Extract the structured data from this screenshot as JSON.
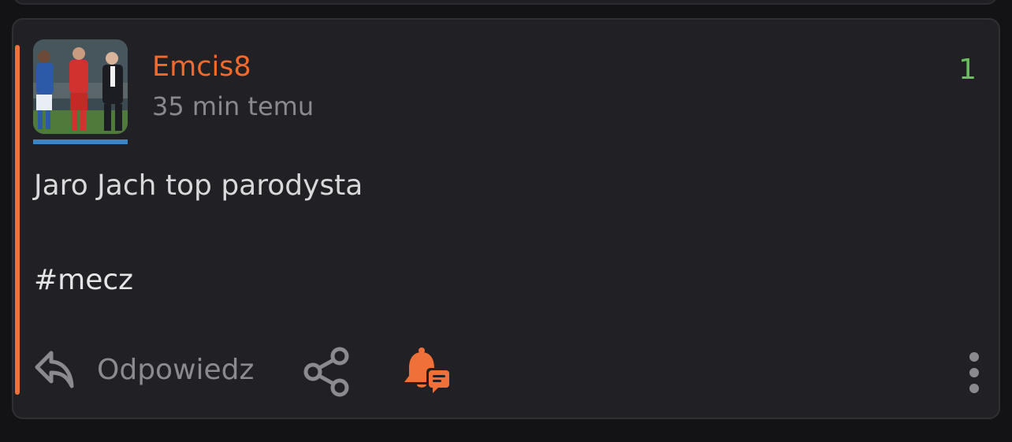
{
  "post": {
    "author": "Emcis8",
    "timestamp": "35 min temu",
    "vote_count": "1",
    "body": "Jaro Jach top parodysta",
    "tag": "#mecz"
  },
  "actions": {
    "reply_label": "Odpowiedz",
    "reply_icon": "reply-arrow-icon",
    "share_icon": "share-icon",
    "notify_icon": "bell-comment-icon",
    "more_icon": "more-vertical-icon"
  },
  "colors": {
    "background": "#131315",
    "card": "#212125",
    "accent": "#f0703a",
    "username": "#f46a2a",
    "vote": "#6cbf5e",
    "muted": "#8b8b8f",
    "avatar_underline": "#3d84c4"
  }
}
